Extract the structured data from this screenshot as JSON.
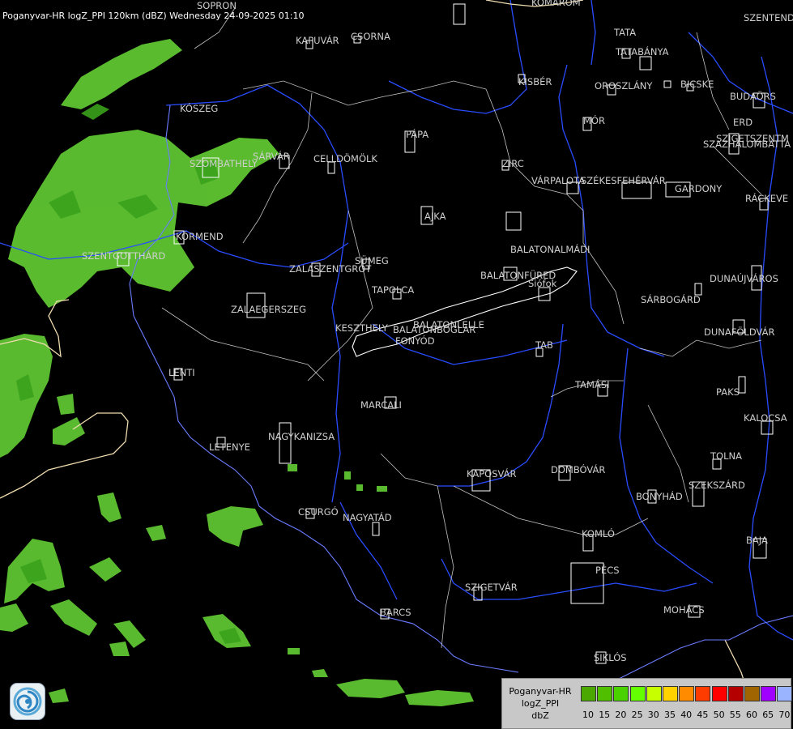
{
  "title": "Poganyvar-HR logZ_PPI 120km (dBZ) Wednesday 24-09-2025 01:10",
  "cities": [
    {
      "name": "SOPRON"
    },
    {
      "name": "KOMÁROM"
    },
    {
      "name": "SZENTENDRE"
    },
    {
      "name": "KAPUVÁR"
    },
    {
      "name": "CSORNA"
    },
    {
      "name": "TATA"
    },
    {
      "name": "TATABÁNYA"
    },
    {
      "name": "KISBÉR"
    },
    {
      "name": "OROSZLÁNY"
    },
    {
      "name": "BICSKE"
    },
    {
      "name": "BUDAÖRS"
    },
    {
      "name": "KÓSZEG"
    },
    {
      "name": "MÓR"
    },
    {
      "name": "ERD"
    },
    {
      "name": "SZIGETSZENTM"
    },
    {
      "name": "SZAZHALOMBATTA"
    },
    {
      "name": "PÁPA"
    },
    {
      "name": "SÁRVÁR"
    },
    {
      "name": "CELLDÖMÖLK"
    },
    {
      "name": "SZOMBATHELY"
    },
    {
      "name": "ZIRC"
    },
    {
      "name": "VÁRPALOTA"
    },
    {
      "name": "SZÉKESFEHÉRVÁR"
    },
    {
      "name": "GARDONY"
    },
    {
      "name": "RÁCKEVE"
    },
    {
      "name": "AJKA"
    },
    {
      "name": "KÖRMEND"
    },
    {
      "name": "BALATONALMÁDI"
    },
    {
      "name": "SZENTGOTTHÁRD"
    },
    {
      "name": "SÜMEG"
    },
    {
      "name": "ZALASZENTGRÓT"
    },
    {
      "name": "BALATONFÜRED"
    },
    {
      "name": "DUNAÚJVÁROS"
    },
    {
      "name": "SIÓFOK"
    },
    {
      "name": "TAPOLCA"
    },
    {
      "name": "ZALAEGERSZEG"
    },
    {
      "name": "SÁRBOGÁRD"
    },
    {
      "name": "BALATONLELLE"
    },
    {
      "name": "KESZTHELY"
    },
    {
      "name": "BALATONBOGLÁR"
    },
    {
      "name": "DUNAFÖLDVÁR"
    },
    {
      "name": "FONYÓD"
    },
    {
      "name": "TAB"
    },
    {
      "name": "LENTI"
    },
    {
      "name": "TAMÁSI"
    },
    {
      "name": "PAKS"
    },
    {
      "name": "MARCALI"
    },
    {
      "name": "KALOCSA"
    },
    {
      "name": "LETENYE"
    },
    {
      "name": "NAGYKANIZSA"
    },
    {
      "name": "TOLNA"
    },
    {
      "name": "KAPOSVÁR"
    },
    {
      "name": "DOMBÓVÁR"
    },
    {
      "name": "SZEKSZÁRD"
    },
    {
      "name": "BONYHÁD"
    },
    {
      "name": "CSURGÓ"
    },
    {
      "name": "NAGYATÁD"
    },
    {
      "name": "KOMLÓ"
    },
    {
      "name": "BAJA"
    },
    {
      "name": "PÉCS"
    },
    {
      "name": "SZIGETVÁR"
    },
    {
      "name": "MOHÁCS"
    },
    {
      "name": "BARCS"
    },
    {
      "name": "SIKLÓS"
    },
    {
      "name": "Siófok"
    }
  ],
  "legend": {
    "line1": "Poganyvar-HR",
    "line2": "logZ_PPI",
    "line3": "dbZ",
    "bins": [
      {
        "value": "10",
        "color": "#4aa800"
      },
      {
        "value": "15",
        "color": "#4fbf00"
      },
      {
        "value": "20",
        "color": "#49d200"
      },
      {
        "value": "25",
        "color": "#64ff00"
      },
      {
        "value": "30",
        "color": "#c8ff00"
      },
      {
        "value": "35",
        "color": "#ffd200"
      },
      {
        "value": "40",
        "color": "#ff8c00"
      },
      {
        "value": "45",
        "color": "#ff3c00"
      },
      {
        "value": "50",
        "color": "#ff0000"
      },
      {
        "value": "55",
        "color": "#b40000"
      },
      {
        "value": "60",
        "color": "#a06400"
      },
      {
        "value": "65",
        "color": "#a000ff"
      },
      {
        "value": "70",
        "color": "#9ab4ff"
      }
    ]
  },
  "colors": {
    "background": "#000000",
    "river": "#2244ff",
    "border": "#f0e0b0",
    "echo": "#64c83c"
  }
}
